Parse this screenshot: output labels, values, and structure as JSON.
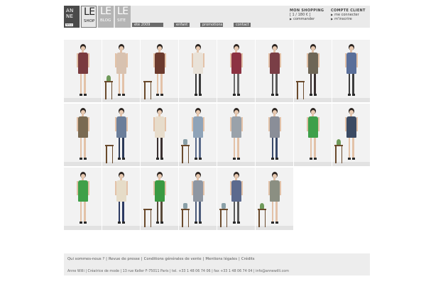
{
  "logo": {
    "anne": {
      "line1": "AN",
      "line2": "NE",
      "tag": "WILLI"
    },
    "shop": {
      "big": "LE",
      "label": "SHOP"
    },
    "blog": {
      "big": "LE",
      "label": "BLOG"
    },
    "site": {
      "big": "LE",
      "label": "SITE"
    }
  },
  "nav": [
    "été 2009",
    "enfant",
    "promotions",
    "contact"
  ],
  "shopping": {
    "title": "MON SHOPPING",
    "summary": "[ 1 / 180 € ]",
    "link": "commander"
  },
  "compte": {
    "title": "COMPTE CLIENT",
    "link1": "me connecter",
    "link2": "m'inscrire"
  },
  "products": [
    {
      "dress": "#7a3b3f",
      "legs": "#e3c2a8",
      "props": "none"
    },
    {
      "dress": "#d8c2b0",
      "legs": "#e3c2a8",
      "props": "stool-plant"
    },
    {
      "dress": "#6b3a2e",
      "legs": "#e3c2a8",
      "props": "chair"
    },
    {
      "dress": "#e9e2d8",
      "legs": "#3a3a3a",
      "props": "none"
    },
    {
      "dress": "#8c3242",
      "legs": "#6c6c6c",
      "props": "none"
    },
    {
      "dress": "#7a3e46",
      "legs": "#5a5a5a",
      "props": "none"
    },
    {
      "dress": "#6e6656",
      "legs": "#3a3030",
      "props": "stool"
    },
    {
      "dress": "#5a6f9a",
      "legs": "#3d3d3d",
      "props": "none"
    },
    {
      "dress": "#7a6a52",
      "legs": "#e3c2a8",
      "props": "none"
    },
    {
      "dress": "#6b7e9a",
      "legs": "#2c3a58",
      "props": "chair"
    },
    {
      "dress": "#e7dccb",
      "legs": "#3a3030",
      "props": "none"
    },
    {
      "dress": "#8fa3b8",
      "legs": "#5a6a8a",
      "props": "stool-vase"
    },
    {
      "dress": "#9aa2aa",
      "legs": "#e3c2a8",
      "props": "none"
    },
    {
      "dress": "#8a8e98",
      "legs": "#3a4a6a",
      "props": "none"
    },
    {
      "dress": "#3fa04a",
      "legs": "#e3c2a8",
      "props": "none"
    },
    {
      "dress": "#3b4a63",
      "legs": "#e3c2a8",
      "props": "stool-plant"
    },
    {
      "dress": "#3fa048",
      "legs": "#e3c2a8",
      "props": "none"
    },
    {
      "dress": "#e6dcc8",
      "legs": "#2c3a62",
      "props": "none"
    },
    {
      "dress": "#3a9a42",
      "legs": "#5a4a3a",
      "props": "chair"
    },
    {
      "dress": "#8e96a2",
      "legs": "#4a5a7a",
      "props": "stool-vase"
    },
    {
      "dress": "#5c6a8e",
      "legs": "#5a5a5a",
      "props": "stool-vase"
    },
    {
      "dress": "#8b8f82",
      "legs": "#e3c2a8",
      "props": "stool-plant"
    }
  ],
  "footer": {
    "links": [
      "Qui sommes-nous ?",
      "Revue de presse",
      "Conditions générales de vente",
      "Mentions légales",
      "Crédits"
    ],
    "address": "Anne Willi | Créatrice de mode | 13 rue Keller F-75011 Paris | tel. +33 1 48 06 74 06 | fax +33 1 48 06 74 04 | info@annewilli.com"
  }
}
